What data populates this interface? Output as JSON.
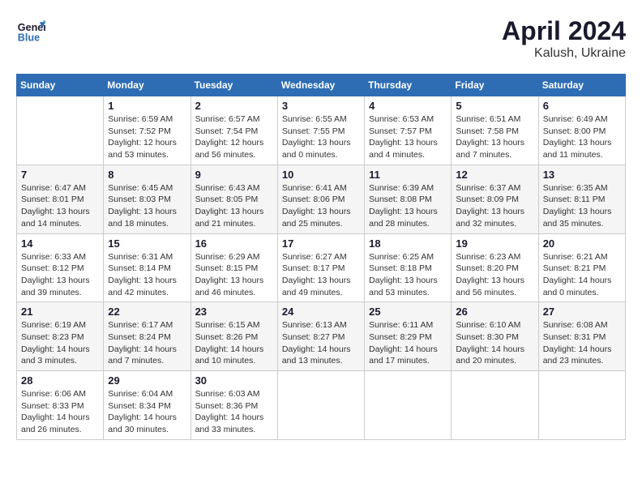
{
  "header": {
    "logo_line1": "General",
    "logo_line2": "Blue",
    "month_year": "April 2024",
    "location": "Kalush, Ukraine"
  },
  "weekdays": [
    "Sunday",
    "Monday",
    "Tuesday",
    "Wednesday",
    "Thursday",
    "Friday",
    "Saturday"
  ],
  "weeks": [
    [
      {
        "day": "",
        "info": ""
      },
      {
        "day": "1",
        "info": "Sunrise: 6:59 AM\nSunset: 7:52 PM\nDaylight: 12 hours\nand 53 minutes."
      },
      {
        "day": "2",
        "info": "Sunrise: 6:57 AM\nSunset: 7:54 PM\nDaylight: 12 hours\nand 56 minutes."
      },
      {
        "day": "3",
        "info": "Sunrise: 6:55 AM\nSunset: 7:55 PM\nDaylight: 13 hours\nand 0 minutes."
      },
      {
        "day": "4",
        "info": "Sunrise: 6:53 AM\nSunset: 7:57 PM\nDaylight: 13 hours\nand 4 minutes."
      },
      {
        "day": "5",
        "info": "Sunrise: 6:51 AM\nSunset: 7:58 PM\nDaylight: 13 hours\nand 7 minutes."
      },
      {
        "day": "6",
        "info": "Sunrise: 6:49 AM\nSunset: 8:00 PM\nDaylight: 13 hours\nand 11 minutes."
      }
    ],
    [
      {
        "day": "7",
        "info": "Sunrise: 6:47 AM\nSunset: 8:01 PM\nDaylight: 13 hours\nand 14 minutes."
      },
      {
        "day": "8",
        "info": "Sunrise: 6:45 AM\nSunset: 8:03 PM\nDaylight: 13 hours\nand 18 minutes."
      },
      {
        "day": "9",
        "info": "Sunrise: 6:43 AM\nSunset: 8:05 PM\nDaylight: 13 hours\nand 21 minutes."
      },
      {
        "day": "10",
        "info": "Sunrise: 6:41 AM\nSunset: 8:06 PM\nDaylight: 13 hours\nand 25 minutes."
      },
      {
        "day": "11",
        "info": "Sunrise: 6:39 AM\nSunset: 8:08 PM\nDaylight: 13 hours\nand 28 minutes."
      },
      {
        "day": "12",
        "info": "Sunrise: 6:37 AM\nSunset: 8:09 PM\nDaylight: 13 hours\nand 32 minutes."
      },
      {
        "day": "13",
        "info": "Sunrise: 6:35 AM\nSunset: 8:11 PM\nDaylight: 13 hours\nand 35 minutes."
      }
    ],
    [
      {
        "day": "14",
        "info": "Sunrise: 6:33 AM\nSunset: 8:12 PM\nDaylight: 13 hours\nand 39 minutes."
      },
      {
        "day": "15",
        "info": "Sunrise: 6:31 AM\nSunset: 8:14 PM\nDaylight: 13 hours\nand 42 minutes."
      },
      {
        "day": "16",
        "info": "Sunrise: 6:29 AM\nSunset: 8:15 PM\nDaylight: 13 hours\nand 46 minutes."
      },
      {
        "day": "17",
        "info": "Sunrise: 6:27 AM\nSunset: 8:17 PM\nDaylight: 13 hours\nand 49 minutes."
      },
      {
        "day": "18",
        "info": "Sunrise: 6:25 AM\nSunset: 8:18 PM\nDaylight: 13 hours\nand 53 minutes."
      },
      {
        "day": "19",
        "info": "Sunrise: 6:23 AM\nSunset: 8:20 PM\nDaylight: 13 hours\nand 56 minutes."
      },
      {
        "day": "20",
        "info": "Sunrise: 6:21 AM\nSunset: 8:21 PM\nDaylight: 14 hours\nand 0 minutes."
      }
    ],
    [
      {
        "day": "21",
        "info": "Sunrise: 6:19 AM\nSunset: 8:23 PM\nDaylight: 14 hours\nand 3 minutes."
      },
      {
        "day": "22",
        "info": "Sunrise: 6:17 AM\nSunset: 8:24 PM\nDaylight: 14 hours\nand 7 minutes."
      },
      {
        "day": "23",
        "info": "Sunrise: 6:15 AM\nSunset: 8:26 PM\nDaylight: 14 hours\nand 10 minutes."
      },
      {
        "day": "24",
        "info": "Sunrise: 6:13 AM\nSunset: 8:27 PM\nDaylight: 14 hours\nand 13 minutes."
      },
      {
        "day": "25",
        "info": "Sunrise: 6:11 AM\nSunset: 8:29 PM\nDaylight: 14 hours\nand 17 minutes."
      },
      {
        "day": "26",
        "info": "Sunrise: 6:10 AM\nSunset: 8:30 PM\nDaylight: 14 hours\nand 20 minutes."
      },
      {
        "day": "27",
        "info": "Sunrise: 6:08 AM\nSunset: 8:31 PM\nDaylight: 14 hours\nand 23 minutes."
      }
    ],
    [
      {
        "day": "28",
        "info": "Sunrise: 6:06 AM\nSunset: 8:33 PM\nDaylight: 14 hours\nand 26 minutes."
      },
      {
        "day": "29",
        "info": "Sunrise: 6:04 AM\nSunset: 8:34 PM\nDaylight: 14 hours\nand 30 minutes."
      },
      {
        "day": "30",
        "info": "Sunrise: 6:03 AM\nSunset: 8:36 PM\nDaylight: 14 hours\nand 33 minutes."
      },
      {
        "day": "",
        "info": ""
      },
      {
        "day": "",
        "info": ""
      },
      {
        "day": "",
        "info": ""
      },
      {
        "day": "",
        "info": ""
      }
    ]
  ]
}
